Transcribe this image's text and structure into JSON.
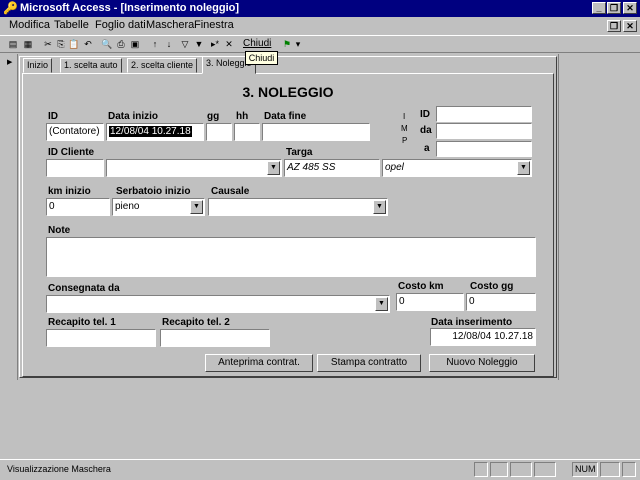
{
  "window": {
    "title": "Microsoft Access - [Inserimento noleggio]"
  },
  "menu": [
    "Modifica",
    "Tabelle",
    "Foglio dati",
    "Maschera",
    "Finestra"
  ],
  "toolbar": {
    "chiudi_label": "Chiudi",
    "tooltip": "Chiudi"
  },
  "tabs": [
    "Inizio",
    "1. scelta auto",
    "2. scelta cliente",
    "3. Noleggio"
  ],
  "form": {
    "heading": "3. NOLEGGIO",
    "labels": {
      "id": "ID",
      "data_inizio": "Data inizio",
      "gg": "gg",
      "hh": "hh",
      "data_fine": "Data fine",
      "imp_i": "I",
      "imp_m": "M",
      "imp_p": "P",
      "id2": "ID",
      "da": "da",
      "a": "a",
      "id_cliente": "ID Cliente",
      "targa": "Targa",
      "km_inizio": "km inizio",
      "serbatoio_inizio": "Serbatoio inizio",
      "causale": "Causale",
      "note": "Note",
      "consegnata_da": "Consegnata da",
      "costo_km": "Costo km",
      "costo_gg": "Costo gg",
      "recapito1": "Recapito tel. 1",
      "recapito2": "Recapito tel. 2",
      "data_inserimento": "Data inserimento"
    },
    "values": {
      "id": "(Contatore)",
      "data_inizio": "12/08/04 10.27.18",
      "gg": "",
      "hh": "",
      "data_fine": "",
      "imp_id": "",
      "imp_da": "",
      "imp_a": "",
      "id_cliente": "",
      "cliente": "",
      "targa": "AZ 485 SS",
      "modello": "opel",
      "km_inizio": "0",
      "serbatoio": "pieno",
      "causale": "",
      "note": "",
      "consegnata_da": "",
      "costo_km": "0",
      "costo_gg": "0",
      "recapito1": "",
      "recapito2": "",
      "data_inserimento": "12/08/04 10.27.18"
    },
    "buttons": {
      "anteprima": "Anteprima contrat.",
      "stampa": "Stampa contratto",
      "nuovo": "Nuovo Noleggio"
    }
  },
  "status": {
    "text": "Visualizzazione Maschera",
    "num": "NUM"
  }
}
